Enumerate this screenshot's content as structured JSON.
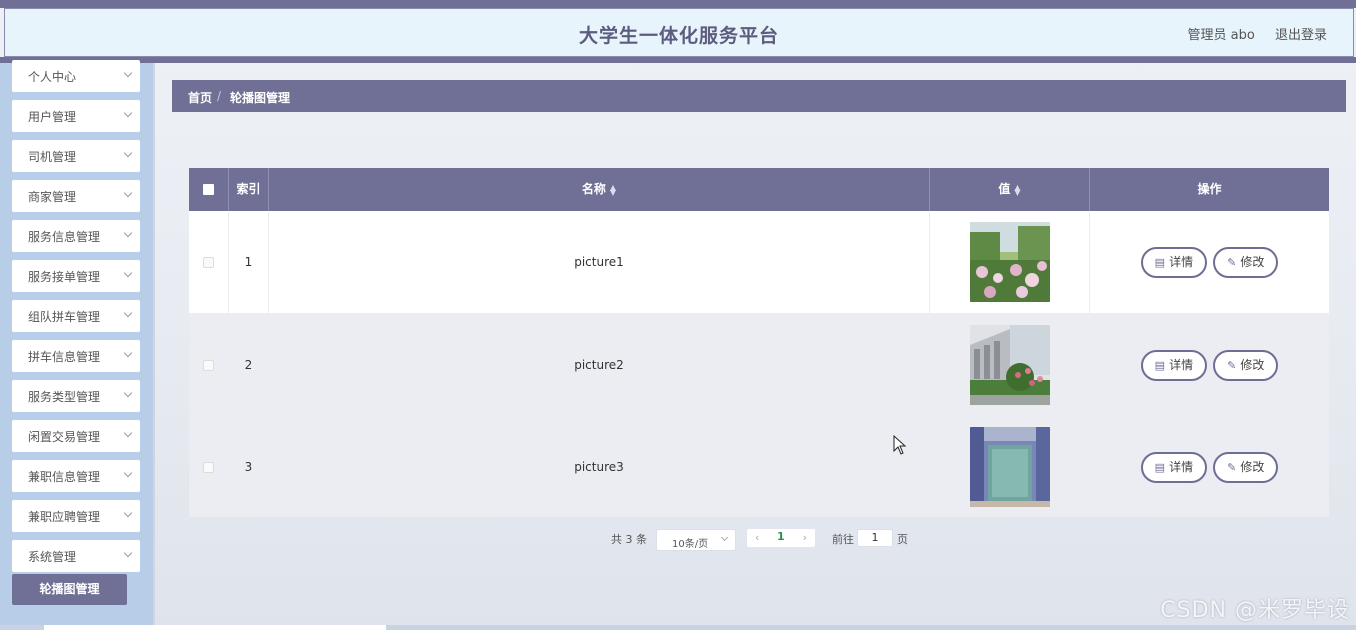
{
  "header": {
    "title": "大学生一体化服务平台",
    "user_label": "管理员 abo",
    "logout_label": "退出登录"
  },
  "sidebar": {
    "items": [
      {
        "label": "个人中心"
      },
      {
        "label": "用户管理"
      },
      {
        "label": "司机管理"
      },
      {
        "label": "商家管理"
      },
      {
        "label": "服务信息管理"
      },
      {
        "label": "服务接单管理"
      },
      {
        "label": "组队拼车管理"
      },
      {
        "label": "拼车信息管理"
      },
      {
        "label": "服务类型管理"
      },
      {
        "label": "闲置交易管理"
      },
      {
        "label": "兼职信息管理"
      },
      {
        "label": "兼职应聘管理"
      },
      {
        "label": "系统管理"
      }
    ],
    "active_sub": "轮播图管理"
  },
  "breadcrumb": {
    "home": "首页",
    "separator": "/",
    "current": "轮播图管理"
  },
  "table": {
    "columns": {
      "index": "索引",
      "name": "名称",
      "value": "值",
      "actions": "操作"
    },
    "rows": [
      {
        "index": "1",
        "name": "picture1",
        "thumb": "flower-garden"
      },
      {
        "index": "2",
        "name": "picture2",
        "thumb": "campus-building"
      },
      {
        "index": "3",
        "name": "picture3",
        "thumb": "doorway"
      }
    ],
    "detail_label": "详情",
    "edit_label": "修改"
  },
  "pagination": {
    "total": "共 3 条",
    "page_size": "10条/页",
    "current_page": "1",
    "goto_label": "前往",
    "goto_value": "1",
    "goto_unit": "页"
  },
  "watermark": "CSDN @米罗毕设",
  "colors": {
    "accent": "#707096",
    "header_bg": "#e8f4fb",
    "sidebar_bg": "#b7cde8"
  }
}
